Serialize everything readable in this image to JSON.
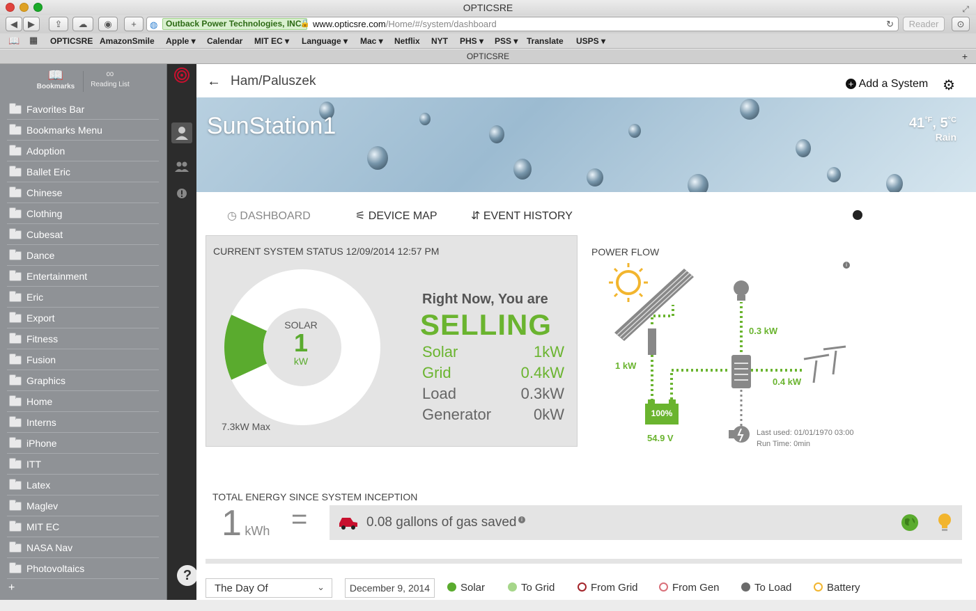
{
  "window": {
    "title": "OPTICSRE"
  },
  "toolbar": {
    "ev_badge": "Outback Power Technologies, INC.",
    "url_host": "www.opticsre.com",
    "url_path": "/Home/#/system/dashboard",
    "reader_label": "Reader"
  },
  "bookmarks_bar": [
    "OPTICSRE",
    "AmazonSmile",
    "Apple ▾",
    "Calendar",
    "MIT EC ▾",
    "Language ▾",
    "Mac ▾",
    "Netflix",
    "NYT",
    "PHS ▾",
    "PSS ▾",
    "Translate",
    "USPS ▾"
  ],
  "tab": {
    "title": "OPTICSRE"
  },
  "sidebar": {
    "tabs": [
      {
        "label": "Bookmarks"
      },
      {
        "label": "Reading List"
      }
    ],
    "items": [
      "Favorites Bar",
      "Bookmarks Menu",
      "Adoption",
      "Ballet Eric",
      "Chinese",
      "Clothing",
      "Cubesat",
      "Dance",
      "Entertainment",
      "Eric",
      "Export",
      "Fitness",
      "Fusion",
      "Graphics",
      "Home",
      "Interns",
      "iPhone",
      "ITT",
      "Latex",
      "Maglev",
      "MIT EC",
      "NASA Nav",
      "Photovoltaics"
    ],
    "add_label": "+"
  },
  "header": {
    "breadcrumb": "Ham/Paluszek",
    "add_system": "Add a System"
  },
  "hero": {
    "station": "SunStation1",
    "temp_f": "41",
    "unit_f": "°F",
    "temp_c": ", 5",
    "unit_c": "°C",
    "condition": "Rain"
  },
  "nav": {
    "dashboard": "DASHBOARD",
    "device_map": "DEVICE MAP",
    "event_history": "EVENT HISTORY"
  },
  "status": {
    "heading": "CURRENT SYSTEM STATUS 12/09/2014 12:57 PM",
    "donut_label": "SOLAR",
    "donut_value": "1",
    "donut_unit": "kW",
    "max": "7.3kW Max",
    "right_now": "Right Now, You are",
    "state": "SELLING",
    "rows": [
      {
        "label": "Solar",
        "value": "1kW"
      },
      {
        "label": "Grid",
        "value": "0.4kW"
      },
      {
        "label": "Load",
        "value": "0.3kW"
      },
      {
        "label": "Generator",
        "value": "0kW"
      }
    ],
    "solar_fraction": 0.137
  },
  "flow": {
    "heading": "POWER FLOW",
    "solar_kw": "1 kW",
    "load_kw": "0.3 kW",
    "grid_kw": "0.4 kW",
    "battery_pct": "100%",
    "battery_v": "54.9 V",
    "gen_last_used": "Last used: 01/01/1970 03:00",
    "gen_runtime": "Run Time: 0min"
  },
  "energy": {
    "heading": "TOTAL ENERGY SINCE SYSTEM INCEPTION",
    "value": "1",
    "unit": "kWh",
    "equals": "=",
    "savings": "0.08 gallons of gas saved"
  },
  "controls": {
    "range": "The Day Of",
    "date": "December 9, 2014",
    "help": "?"
  },
  "legend": [
    {
      "label": "Solar",
      "color": "#5aab2e",
      "filled": true
    },
    {
      "label": "To Grid",
      "color": "#a6d68a",
      "filled": true
    },
    {
      "label": "From Grid",
      "color": "#a3242a",
      "filled": false
    },
    {
      "label": "From Gen",
      "color": "#d9707a",
      "filled": false
    },
    {
      "label": "To Load",
      "color": "#6b6b6b",
      "filled": true
    },
    {
      "label": "Battery",
      "color": "#f2b52e",
      "filled": false
    }
  ],
  "colors": {
    "accent_green": "#6ab42f",
    "text_gray": "#555555",
    "sidebar": "#8f9296",
    "app_nav": "#2c2c2c"
  }
}
